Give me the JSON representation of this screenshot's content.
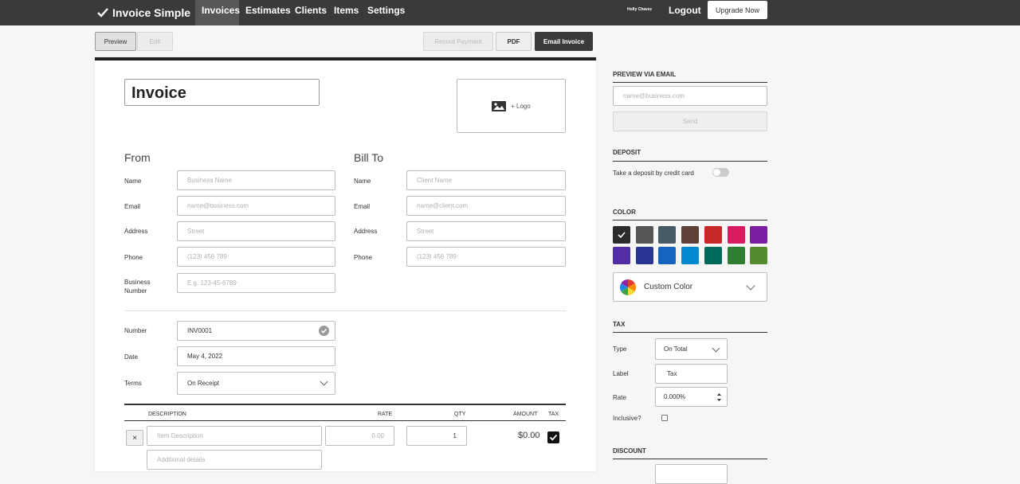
{
  "nav": {
    "brand": "Invoice Simple",
    "links": [
      "Invoices",
      "Estimates",
      "Clients",
      "Items",
      "Settings"
    ],
    "user": "Holly Chavez",
    "logout": "Logout",
    "upgrade": "Upgrade Now"
  },
  "toolbar": {
    "preview": "Preview",
    "edit": "Edit",
    "record_payment": "Record Payment",
    "pdf": "PDF",
    "email_invoice": "Email Invoice"
  },
  "doc": {
    "title": "Invoice",
    "logo": "+ Logo",
    "from": {
      "heading": "From",
      "name_label": "Name",
      "name_ph": "Business Name",
      "email_label": "Email",
      "email_ph": "name@business.com",
      "address_label": "Address",
      "address_ph": "Street",
      "phone_label": "Phone",
      "phone_ph": "(123) 456 789",
      "bn_label_1": "Business",
      "bn_label_2": "Number",
      "bn_ph": "E.g. 123-45-6789"
    },
    "billto": {
      "heading": "Bill To",
      "name_label": "Name",
      "name_ph": "Client Name",
      "email_label": "Email",
      "email_ph": "name@client.com",
      "address_label": "Address",
      "address_ph": "Street",
      "phone_label": "Phone",
      "phone_ph": "(123) 456 789"
    },
    "meta": {
      "number_label": "Number",
      "number": "INV0001",
      "date_label": "Date",
      "date": "May 4, 2022",
      "terms_label": "Terms",
      "terms": "On Receipt"
    },
    "items": {
      "headers": {
        "description": "DESCRIPTION",
        "rate": "RATE",
        "qty": "QTY",
        "amount": "AMOUNT",
        "tax": "TAX"
      },
      "row": {
        "remove": "×",
        "desc_ph": "Item Description",
        "rate": "0.00",
        "qty": "1",
        "amount": "$0.00",
        "details_ph": "Additional details"
      }
    }
  },
  "side": {
    "preview_heading": "PREVIEW VIA EMAIL",
    "email_ph": "name@business.com",
    "send": "Send",
    "deposit_heading": "DEPOSIT",
    "deposit_text": "Take a deposit by credit card",
    "color_heading": "COLOR",
    "colors": [
      "#2b2b2b",
      "#555555",
      "#455a64",
      "#5d4037",
      "#c62828",
      "#d81b60",
      "#7b1fa2",
      "#512da8",
      "#283593",
      "#1565c0",
      "#0288d1",
      "#00695c",
      "#2e7d32",
      "#558b2f"
    ],
    "custom_color": "Custom Color",
    "tax_heading": "TAX",
    "type_label": "Type",
    "type_value": "On Total",
    "label_label": "Label",
    "label_value": "Tax",
    "rate_label": "Rate",
    "rate_value": "0.000%",
    "inclusive_label": "Inclusive?",
    "discount_heading": "DISCOUNT"
  }
}
